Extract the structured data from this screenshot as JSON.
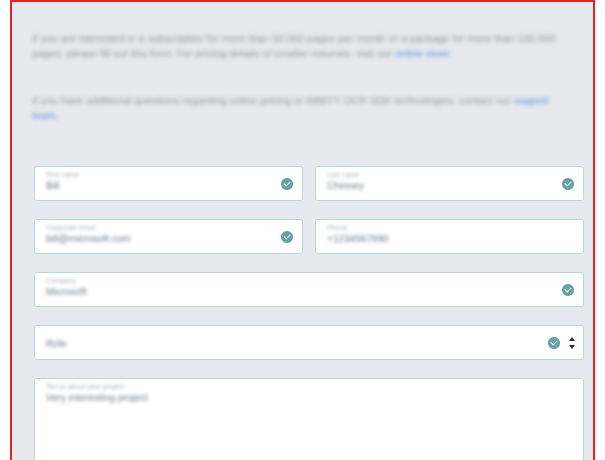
{
  "intro": {
    "p1_text": "If you are interested in a subscription for more than 30,000 pages per month or a package for more than 100,000 pages, please fill out this form. For pricing details of smaller volumes, visit our",
    "p1_link": "online store.",
    "p2_text": "If you have additional questions regarding online pricing or ABBYY OCR SDK technologies, contact our",
    "p2_link": "support team."
  },
  "form": {
    "first_name": {
      "label": "First name",
      "value": "Bill"
    },
    "last_name": {
      "label": "Last name",
      "value": "Chinney"
    },
    "email": {
      "label": "Corporate email",
      "value": "bill@microsoft.com"
    },
    "phone": {
      "label": "Phone",
      "value": "+1234567890"
    },
    "company": {
      "label": "Company",
      "value": "Microsoft"
    },
    "role": {
      "selected": "Role"
    },
    "message": {
      "label": "Tell us about your project",
      "value": "Very interesting project"
    }
  }
}
